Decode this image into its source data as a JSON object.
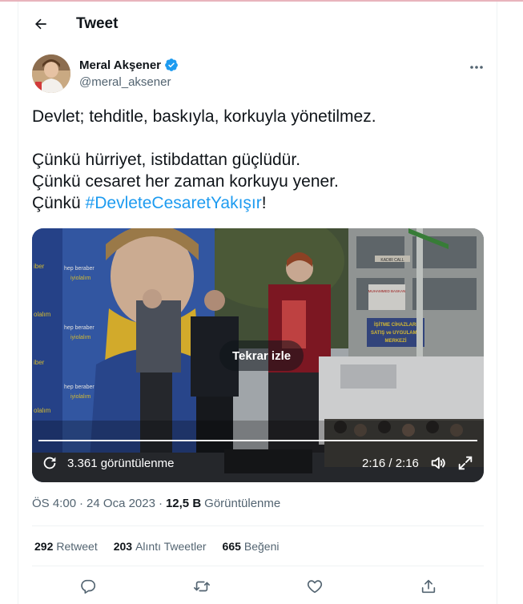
{
  "header": {
    "title": "Tweet",
    "back_icon": "arrow-left-icon"
  },
  "author": {
    "name": "Meral Akşener",
    "handle": "@meral_aksener",
    "verified": true,
    "verified_color": "#1d9bf0"
  },
  "tweet": {
    "line1": "Devlet; tehditle, baskıyla, korkuyla yönetilmez.",
    "line2": "Çünkü hürriyet, istibdattan güçlüdür.",
    "line3": "Çünkü cesaret her zaman korkuyu yener.",
    "line4_prefix": "Çünkü ",
    "hashtag": "#DevleteCesaretYakışır",
    "line4_suffix": "!"
  },
  "video": {
    "replay_label": "Tekrar izle",
    "views": "3.361 görüntülenme",
    "time": "2:16 / 2:16",
    "progress": 1.0,
    "scene_text": {
      "banner_lines": [
        "hep beraber",
        "iyiolalım",
        "hep beraber",
        "iyiolalım",
        "hep beraber",
        "iyiolalım"
      ],
      "banner_side": [
        "iber",
        "olalım",
        "iber",
        "olalım",
        "iber"
      ],
      "street_sign": "KADIR CALL",
      "shop_sign_1": "İŞİTME CİHAZLARI",
      "shop_sign_2": "SATIŞ ve UYGULAMA",
      "shop_sign_3": "MERKEZİ",
      "poster_title": "MUHAMMED BASKAN"
    }
  },
  "meta": {
    "time": "ÖS 4:00",
    "date": "24 Oca 2023",
    "views_count": "12,5 B",
    "views_label": "Görüntülenme"
  },
  "stats": [
    {
      "count": "292",
      "label": "Retweet"
    },
    {
      "count": "203",
      "label": "Alıntı Tweetler"
    },
    {
      "count": "665",
      "label": "Beğeni"
    }
  ],
  "actions": [
    "reply-icon",
    "retweet-icon",
    "like-icon",
    "share-icon"
  ],
  "colors": {
    "accent": "#1d9bf0",
    "text_primary": "#0f1419",
    "text_secondary": "#536471",
    "divider": "#eff3f4"
  }
}
